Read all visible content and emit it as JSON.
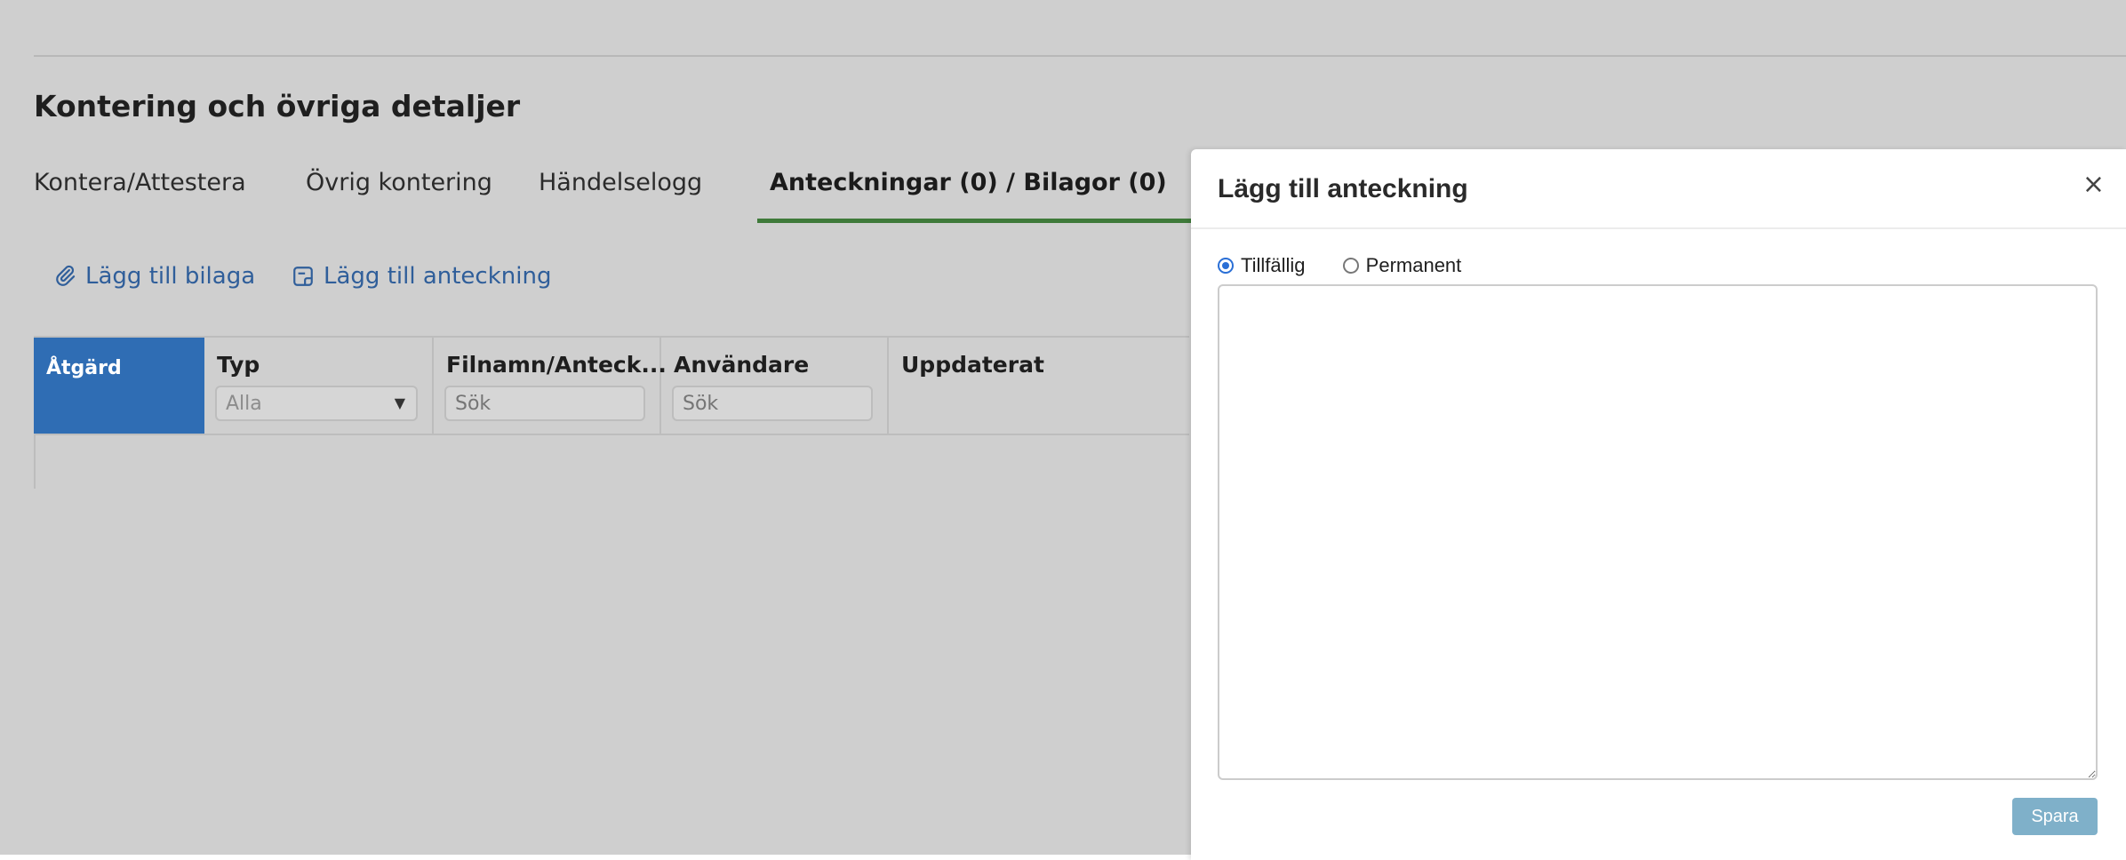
{
  "section": {
    "title": "Kontering och övriga detaljer"
  },
  "tabs": [
    {
      "label": "Kontera/Attestera"
    },
    {
      "label": "Övrig kontering"
    },
    {
      "label": "Händelselogg"
    },
    {
      "label": "Anteckningar (0) / Bilagor (0)"
    }
  ],
  "actions": {
    "add_attachment": "Lägg till bilaga",
    "add_note": "Lägg till anteckning"
  },
  "table": {
    "columns": [
      {
        "label": "Åtgärd"
      },
      {
        "label": "Typ"
      },
      {
        "label": "Filnamn/Anteck..."
      },
      {
        "label": "Användare"
      },
      {
        "label": "Uppdaterat"
      }
    ],
    "filters": {
      "typ_value": "Alla",
      "filename_placeholder": "Sök",
      "user_placeholder": "Sök"
    }
  },
  "dialog": {
    "title": "Lägg till anteckning",
    "close": "×",
    "radio_temporary": "Tillfällig",
    "radio_permanent": "Permanent",
    "selected_radio": "Tillfällig",
    "save_label": "Spara"
  },
  "colors": {
    "accent": "#2f6db4",
    "active_tab_underline": "#3f7a3a",
    "save_button": "#7fb0c9"
  },
  "icons": {
    "attachment": "paperclip-icon",
    "note": "note-icon",
    "close": "close-icon",
    "dropdown": "chevron-down-icon"
  }
}
